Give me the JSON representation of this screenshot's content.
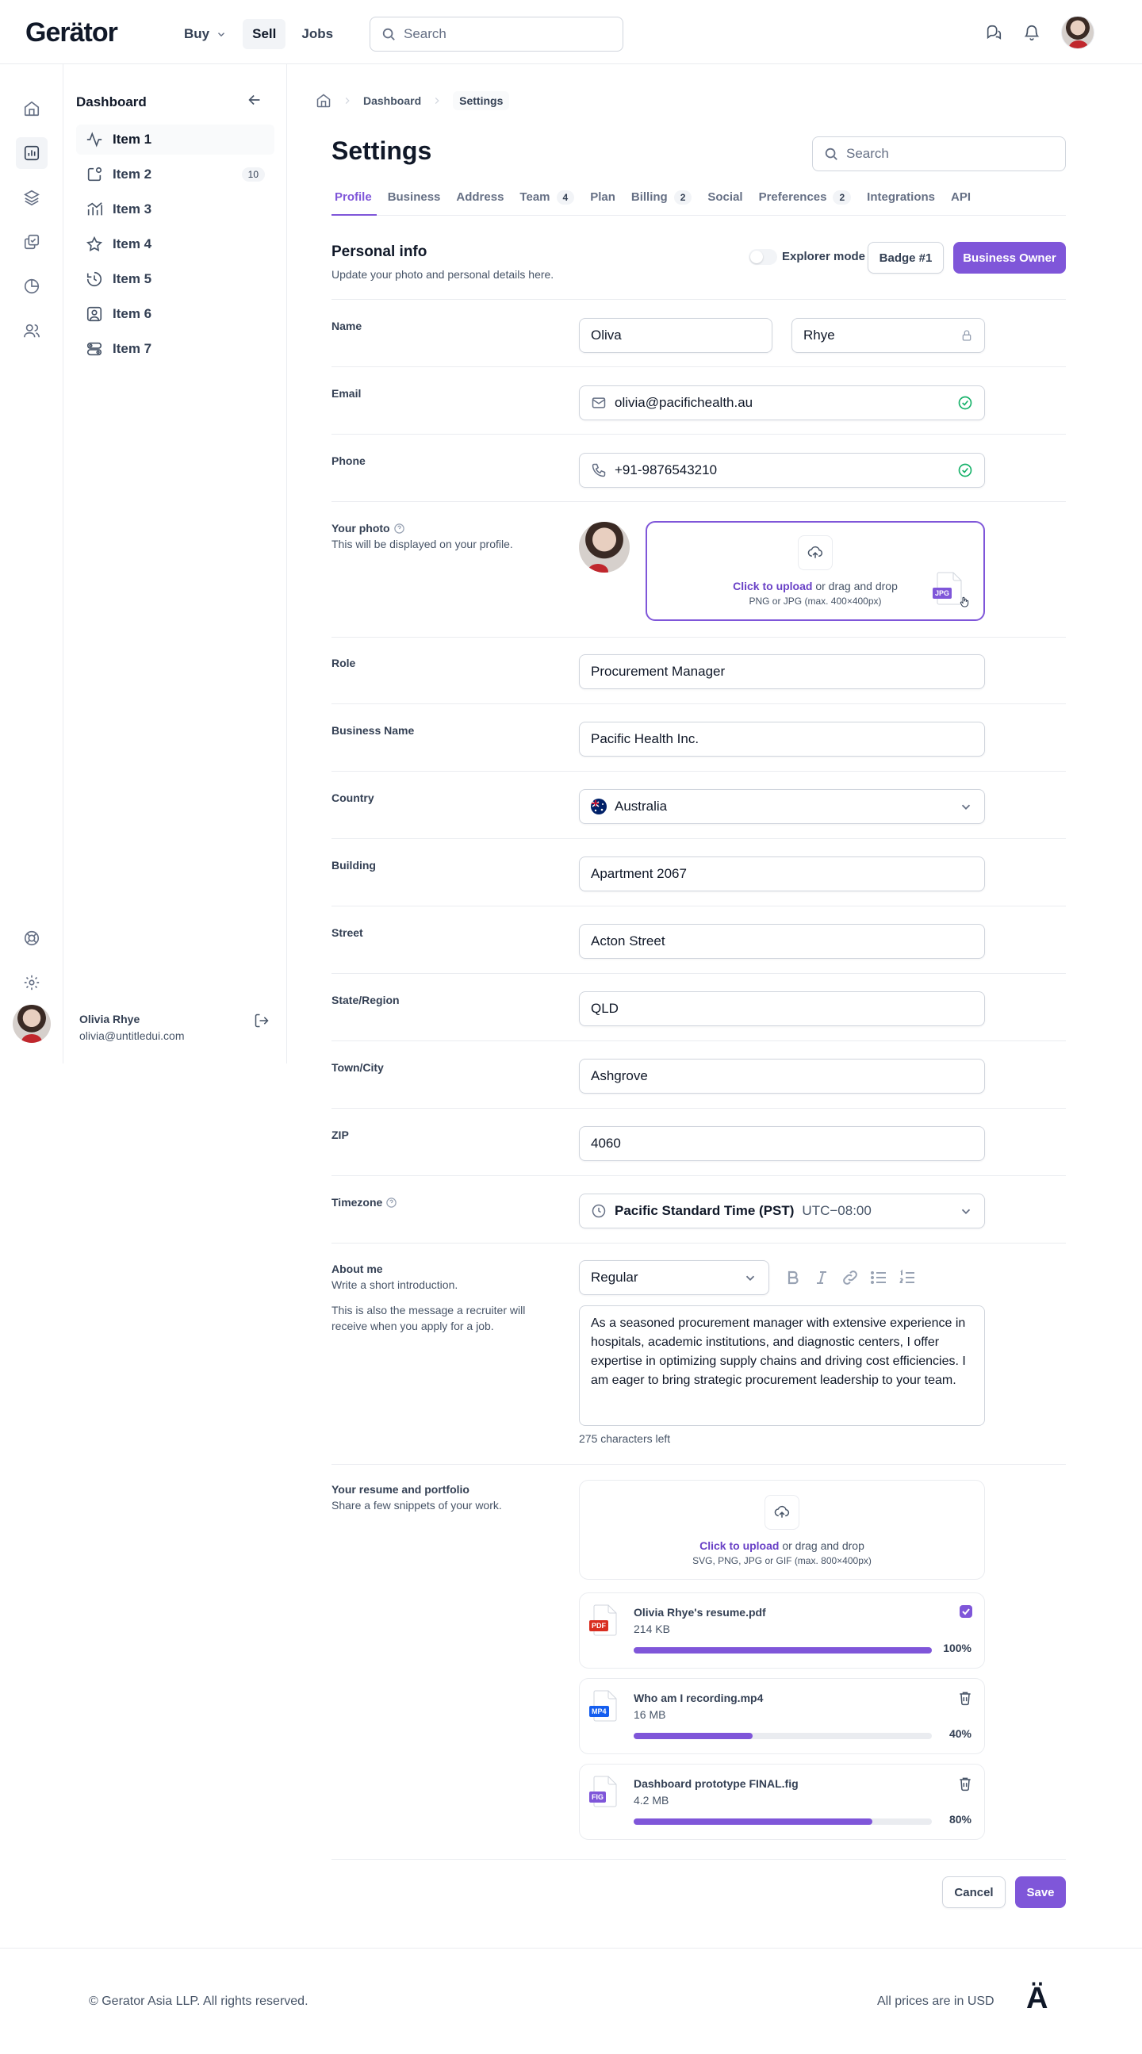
{
  "brand": {
    "logo_text": "Gerätor",
    "footer_mark": "Ä",
    "accent": "#7f56d9"
  },
  "topnav": {
    "items": [
      {
        "label": "Buy",
        "has_dropdown": true
      },
      {
        "label": "Sell",
        "active": true
      },
      {
        "label": "Jobs"
      }
    ],
    "search_placeholder": "Search"
  },
  "sidebar": {
    "title": "Dashboard",
    "items": [
      {
        "label": "Item 1",
        "icon": "activity-icon",
        "active": true
      },
      {
        "label": "Item 2",
        "icon": "notification-box-icon",
        "badge": "10"
      },
      {
        "label": "Item 3",
        "icon": "bar-line-chart-icon"
      },
      {
        "label": "Item 4",
        "icon": "star-icon"
      },
      {
        "label": "Item 5",
        "icon": "clock-rewind-icon"
      },
      {
        "label": "Item 6",
        "icon": "user-square-icon"
      },
      {
        "label": "Item 7",
        "icon": "toggles-icon"
      }
    ],
    "user": {
      "name": "Olivia Rhye",
      "email": "olivia@untitledui.com"
    }
  },
  "breadcrumb": {
    "items": [
      "Dashboard",
      "Settings"
    ]
  },
  "page": {
    "title": "Settings",
    "search_placeholder": "Search"
  },
  "tabs": [
    {
      "label": "Profile",
      "active": true
    },
    {
      "label": "Business"
    },
    {
      "label": "Address"
    },
    {
      "label": "Team",
      "badge": "4"
    },
    {
      "label": "Plan"
    },
    {
      "label": "Billing",
      "badge": "2"
    },
    {
      "label": "Social"
    },
    {
      "label": "Preferences",
      "badge": "2"
    },
    {
      "label": "Integrations"
    },
    {
      "label": "API"
    }
  ],
  "personal_info": {
    "title": "Personal info",
    "subtitle": "Update your photo and personal details here.",
    "explorer_mode_label": "Explorer mode",
    "badge_button": "Badge #1",
    "owner_button": "Business Owner"
  },
  "form": {
    "name": {
      "label": "Name",
      "first": "Oliva",
      "last": "Rhye"
    },
    "email": {
      "label": "Email",
      "value": "olivia@pacifichealth.au"
    },
    "phone": {
      "label": "Phone",
      "value": "+91-9876543210"
    },
    "photo": {
      "label": "Your photo",
      "hint": "This will be displayed on your profile.",
      "upload_link": "Click to upload",
      "upload_text": "or drag and drop",
      "upload_formats": "PNG or JPG (max. 400×400px)",
      "drag_file_type": "JPG"
    },
    "role": {
      "label": "Role",
      "value": "Procurement Manager"
    },
    "business_name": {
      "label": "Business Name",
      "value": "Pacific Health Inc."
    },
    "country": {
      "label": "Country",
      "value": "Australia"
    },
    "building": {
      "label": "Building",
      "value": "Apartment 2067"
    },
    "street": {
      "label": "Street",
      "value": "Acton Street"
    },
    "state": {
      "label": "State/Region",
      "value": "QLD"
    },
    "town": {
      "label": "Town/City",
      "value": "Ashgrove"
    },
    "zip": {
      "label": "ZIP",
      "value": "4060"
    },
    "timezone": {
      "label": "Timezone",
      "value": "Pacific Standard Time (PST)",
      "offset": "UTC−08:00"
    },
    "about": {
      "label": "About me",
      "hint1": "Write a short introduction.",
      "hint2": "This is also the message a recruiter will receive when you apply for a job.",
      "style_value": "Regular",
      "text": "As a seasoned procurement manager with extensive experience in hospitals, academic institutions, and diagnostic centers, I offer expertise in optimizing supply chains and driving cost efficiencies. I am eager to bring strategic procurement leadership to your team.",
      "chars_left": "275 characters left"
    },
    "resume": {
      "label": "Your resume and portfolio",
      "hint": "Share a few snippets of your work.",
      "upload_link": "Click to upload",
      "upload_text": "or drag and drop",
      "upload_formats": "SVG, PNG, JPG or GIF (max. 800×400px)",
      "files": [
        {
          "type": "PDF",
          "type_color": "#d92d20",
          "name": "Olivia Rhye's resume.pdf",
          "size": "214 KB",
          "progress": 100,
          "progress_label": "100%",
          "action": "checkbox"
        },
        {
          "type": "MP4",
          "type_color": "#155eef",
          "name": "Who am I recording.mp4",
          "size": "16 MB",
          "progress": 40,
          "progress_label": "40%",
          "action": "delete"
        },
        {
          "type": "FIG",
          "type_color": "#7f56d9",
          "name": "Dashboard prototype FINAL.fig",
          "size": "4.2 MB",
          "progress": 80,
          "progress_label": "80%",
          "action": "delete"
        }
      ]
    }
  },
  "actions": {
    "cancel": "Cancel",
    "save": "Save"
  },
  "footer": {
    "copyright": "© Gerator Asia LLP. All rights reserved.",
    "currency_note": "All prices are in USD"
  }
}
